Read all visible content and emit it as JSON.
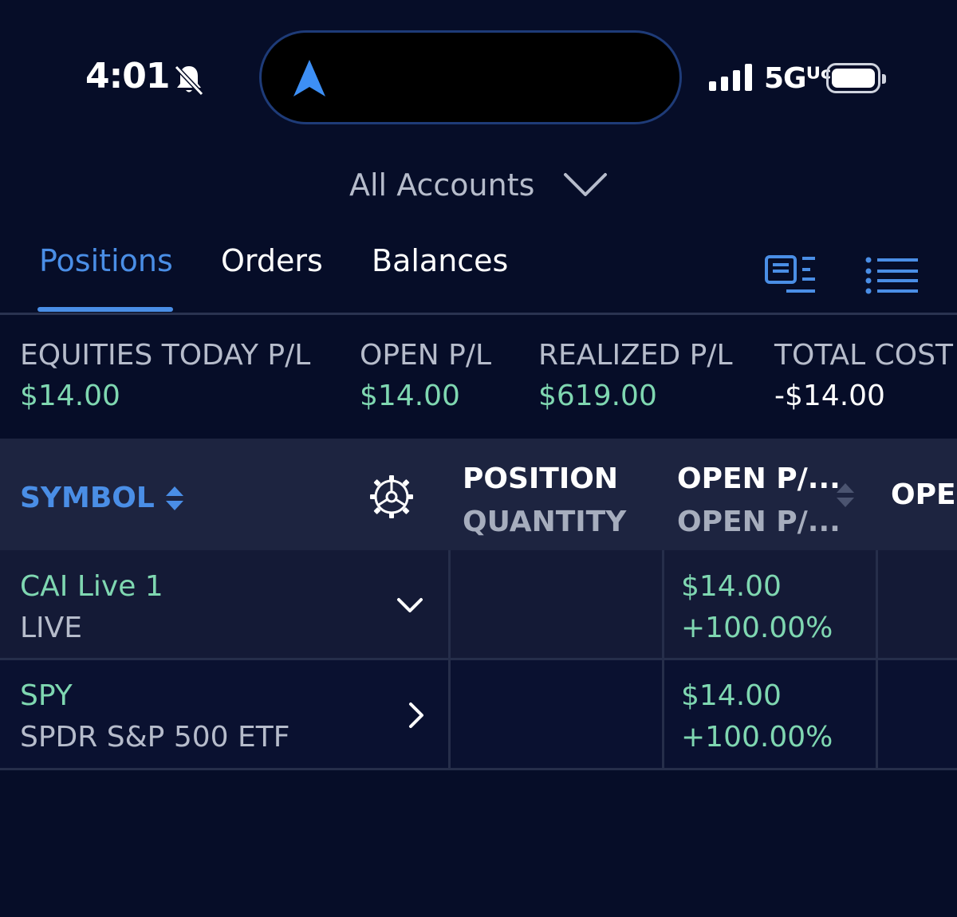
{
  "status_bar": {
    "time": "4:01",
    "network": "5Gᵁᶜ"
  },
  "account_selector": {
    "label": "All Accounts"
  },
  "tabs": [
    {
      "label": "Positions",
      "active": true
    },
    {
      "label": "Orders",
      "active": false
    },
    {
      "label": "Balances",
      "active": false
    }
  ],
  "summary": [
    {
      "label": "EQUITIES TODAY P/L",
      "value": "$14.00",
      "color": "green"
    },
    {
      "label": "OPEN P/L",
      "value": "$14.00",
      "color": "green"
    },
    {
      "label": "REALIZED P/L",
      "value": "$619.00",
      "color": "green"
    },
    {
      "label": "TOTAL COST",
      "value": "-$14.00",
      "color": "white"
    }
  ],
  "table": {
    "headers": {
      "symbol": "SYMBOL",
      "position_line1": "POSITION",
      "position_line2": "QUANTITY",
      "open_pl_line1": "OPEN P/...",
      "open_pl_line2": "OPEN P/...",
      "next_cut": "OPE"
    },
    "rows": [
      {
        "symbol": "CAI Live 1",
        "subtitle": "LIVE",
        "quantity": "",
        "open_pl": "$14.00",
        "open_pl_pct": "+100.00%",
        "expander": "chevron-down"
      },
      {
        "symbol": "SPY",
        "subtitle": "SPDR S&P 500 ETF",
        "quantity": "",
        "open_pl": "$14.00",
        "open_pl_pct": "+100.00%",
        "expander": "chevron-right"
      }
    ]
  },
  "colors": {
    "background": "#060d28",
    "accent_blue": "#4a8ee6",
    "positive_green": "#7fd7b1",
    "header_bg": "#1d2440"
  }
}
